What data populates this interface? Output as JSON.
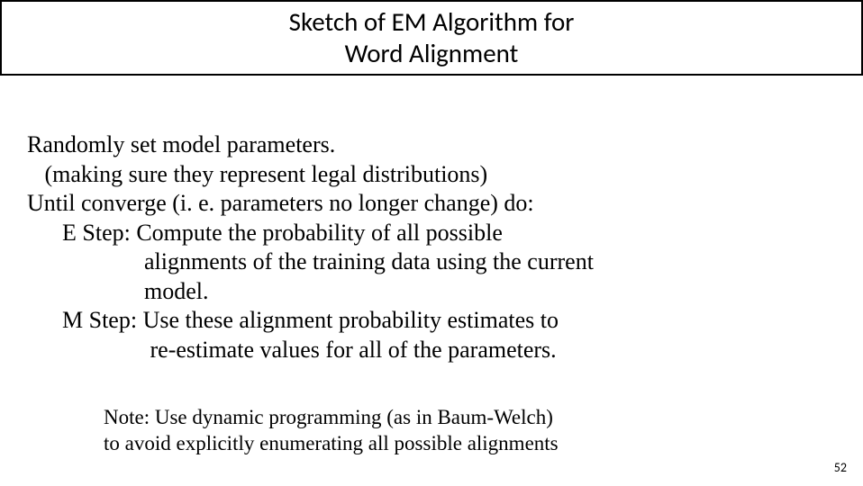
{
  "title": {
    "line1": "Sketch of EM Algorithm for",
    "line2": "Word Alignment"
  },
  "body": {
    "line1": "Randomly set model parameters.",
    "line2": "   (making sure they represent legal distributions)",
    "line3": "Until converge (i. e. parameters no longer change) do:",
    "line4": "      E Step: Compute the probability of all possible",
    "line5": "                    alignments of the training data using the current",
    "line6": "                    model.",
    "line7": "      M Step: Use these alignment probability estimates to",
    "line8": "                     re-estimate values for all of the parameters."
  },
  "note": {
    "line1": "Note: Use dynamic programming (as in Baum-Welch)",
    "line2": "to avoid explicitly enumerating all possible alignments"
  },
  "page_number": "52"
}
